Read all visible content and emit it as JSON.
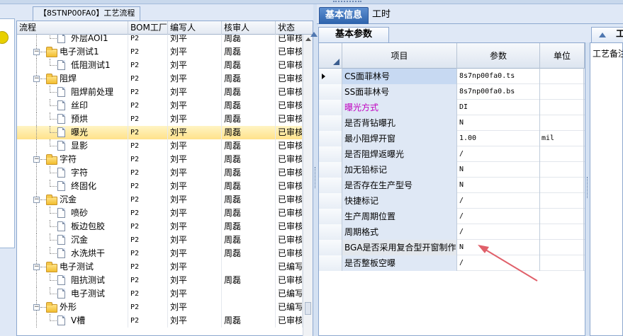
{
  "left_panel": {
    "title_tab": "【8STNP00FA0】工艺流程",
    "columns": [
      "流程",
      "BOM工厂",
      "编写人",
      "核审人",
      "状态"
    ],
    "rows": [
      {
        "level": 2,
        "kind": "doc",
        "name": "外层AOI1",
        "bom": "P2",
        "author": "刘平",
        "reviewer": "周磊",
        "status": "已审核"
      },
      {
        "level": 1,
        "kind": "folder",
        "name": "电子测试1",
        "bom": "P2",
        "author": "刘平",
        "reviewer": "周磊",
        "status": "已审核"
      },
      {
        "level": 2,
        "kind": "doc",
        "name": "低阻测试1",
        "bom": "P2",
        "author": "刘平",
        "reviewer": "周磊",
        "status": "已审核"
      },
      {
        "level": 1,
        "kind": "folder",
        "name": "阻焊",
        "bom": "P2",
        "author": "刘平",
        "reviewer": "周磊",
        "status": "已审核"
      },
      {
        "level": 2,
        "kind": "doc",
        "name": "阻焊前处理",
        "bom": "P2",
        "author": "刘平",
        "reviewer": "周磊",
        "status": "已审核"
      },
      {
        "level": 2,
        "kind": "doc",
        "name": "丝印",
        "bom": "P2",
        "author": "刘平",
        "reviewer": "周磊",
        "status": "已审核"
      },
      {
        "level": 2,
        "kind": "doc",
        "name": "预烘",
        "bom": "P2",
        "author": "刘平",
        "reviewer": "周磊",
        "status": "已审核"
      },
      {
        "level": 2,
        "kind": "doc",
        "name": "曝光",
        "bom": "P2",
        "author": "刘平",
        "reviewer": "周磊",
        "status": "已审核",
        "selected": true
      },
      {
        "level": 2,
        "kind": "doc",
        "name": "显影",
        "bom": "P2",
        "author": "刘平",
        "reviewer": "周磊",
        "status": "已审核"
      },
      {
        "level": 1,
        "kind": "folder",
        "name": "字符",
        "bom": "P2",
        "author": "刘平",
        "reviewer": "周磊",
        "status": "已审核"
      },
      {
        "level": 2,
        "kind": "doc",
        "name": "字符",
        "bom": "P2",
        "author": "刘平",
        "reviewer": "周磊",
        "status": "已审核"
      },
      {
        "level": 2,
        "kind": "doc",
        "name": "终固化",
        "bom": "P2",
        "author": "刘平",
        "reviewer": "周磊",
        "status": "已审核"
      },
      {
        "level": 1,
        "kind": "folder",
        "name": "沉金",
        "bom": "P2",
        "author": "刘平",
        "reviewer": "周磊",
        "status": "已审核"
      },
      {
        "level": 2,
        "kind": "doc",
        "name": "喷砂",
        "bom": "P2",
        "author": "刘平",
        "reviewer": "周磊",
        "status": "已审核"
      },
      {
        "level": 2,
        "kind": "doc",
        "name": "板边包胶",
        "bom": "P2",
        "author": "刘平",
        "reviewer": "周磊",
        "status": "已审核"
      },
      {
        "level": 2,
        "kind": "doc",
        "name": "沉金",
        "bom": "P2",
        "author": "刘平",
        "reviewer": "周磊",
        "status": "已审核"
      },
      {
        "level": 2,
        "kind": "doc",
        "name": "水洗烘干",
        "bom": "P2",
        "author": "刘平",
        "reviewer": "周磊",
        "status": "已审核"
      },
      {
        "level": 1,
        "kind": "folder",
        "name": "电子测试",
        "bom": "P2",
        "author": "刘平",
        "reviewer": "",
        "status": "已编写"
      },
      {
        "level": 2,
        "kind": "doc",
        "name": "阻抗测试",
        "bom": "P2",
        "author": "刘平",
        "reviewer": "周磊",
        "status": "已审核"
      },
      {
        "level": 2,
        "kind": "doc",
        "name": "电子测试",
        "bom": "P2",
        "author": "刘平",
        "reviewer": "",
        "status": "已编写"
      },
      {
        "level": 1,
        "kind": "folder",
        "name": "外形",
        "bom": "P2",
        "author": "刘平",
        "reviewer": "",
        "status": "已编写"
      },
      {
        "level": 2,
        "kind": "doc",
        "name": "V槽",
        "bom": "P2",
        "author": "刘平",
        "reviewer": "周磊",
        "status": "已审核"
      }
    ]
  },
  "right_panel": {
    "tabs": [
      "基本信息",
      "工时"
    ],
    "subtab": "基本参数",
    "side_tab": "工",
    "side_label": "工艺备注",
    "columns": [
      "项目",
      "参数",
      "单位"
    ],
    "rows": [
      {
        "item": "CS面菲林号",
        "param": "8s7np00fa0.ts",
        "unit": "",
        "selected": true
      },
      {
        "item": "SS面菲林号",
        "param": "8s7np00fa0.bs",
        "unit": ""
      },
      {
        "item": "曝光方式",
        "param": "DI",
        "unit": "",
        "highlight": true
      },
      {
        "item": "是否背钻曝孔",
        "param": "N",
        "unit": ""
      },
      {
        "item": "最小阻焊开窗",
        "param": "1.00",
        "unit": "mil"
      },
      {
        "item": "是否阻焊返曝光",
        "param": "/",
        "unit": ""
      },
      {
        "item": "加无铅标记",
        "param": "N",
        "unit": ""
      },
      {
        "item": "是否存在生产型号",
        "param": "N",
        "unit": ""
      },
      {
        "item": "快捷标记",
        "param": "/",
        "unit": ""
      },
      {
        "item": "生产周期位置",
        "param": "/",
        "unit": ""
      },
      {
        "item": "周期格式",
        "param": "/",
        "unit": ""
      },
      {
        "item": "BGA是否采用复合型开窗制作",
        "param": "N",
        "unit": "",
        "gray": true
      },
      {
        "item": "是否整板空曝",
        "param": "/",
        "unit": ""
      }
    ]
  },
  "colors": {
    "highlight_text": "#c000c0",
    "annotation_arrow": "#e0606a",
    "selected_row": "#ffe28a",
    "active_tab": "#2c62ac"
  }
}
